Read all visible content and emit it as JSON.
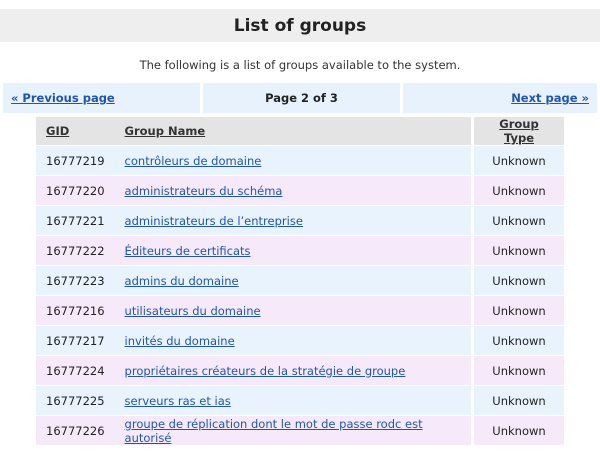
{
  "page": {
    "title": "List of groups",
    "intro": "The following is a list of groups available to the system."
  },
  "pager": {
    "prev_label": "« Previous page",
    "status": "Page 2 of 3",
    "next_label": "Next page »"
  },
  "table": {
    "headers": {
      "gid": "GID",
      "name": "Group Name",
      "type": "Group Type"
    },
    "rows": [
      {
        "gid": "16777219",
        "name": "contrôleurs de domaine",
        "type": "Unknown"
      },
      {
        "gid": "16777220",
        "name": "administrateurs du schéma",
        "type": "Unknown"
      },
      {
        "gid": "16777221",
        "name": "administrateurs de l’entreprise",
        "type": "Unknown"
      },
      {
        "gid": "16777222",
        "name": "Éditeurs de certificats",
        "type": "Unknown"
      },
      {
        "gid": "16777223",
        "name": "admins du domaine",
        "type": "Unknown"
      },
      {
        "gid": "16777216",
        "name": "utilisateurs du domaine",
        "type": "Unknown"
      },
      {
        "gid": "16777217",
        "name": "invités du domaine",
        "type": "Unknown"
      },
      {
        "gid": "16777224",
        "name": "propriétaires créateurs de la stratégie de groupe",
        "type": "Unknown"
      },
      {
        "gid": "16777225",
        "name": "serveurs ras et ias",
        "type": "Unknown"
      },
      {
        "gid": "16777226",
        "name": "groupe de réplication dont le mot de passe rodc est autorisé",
        "type": "Unknown"
      }
    ]
  },
  "colors": {
    "link": "#2255aa",
    "row_odd": "#e8f3fd",
    "row_even": "#f6eafa",
    "header_bg": "#e4e4e4",
    "title_bg": "#eeeeee"
  }
}
